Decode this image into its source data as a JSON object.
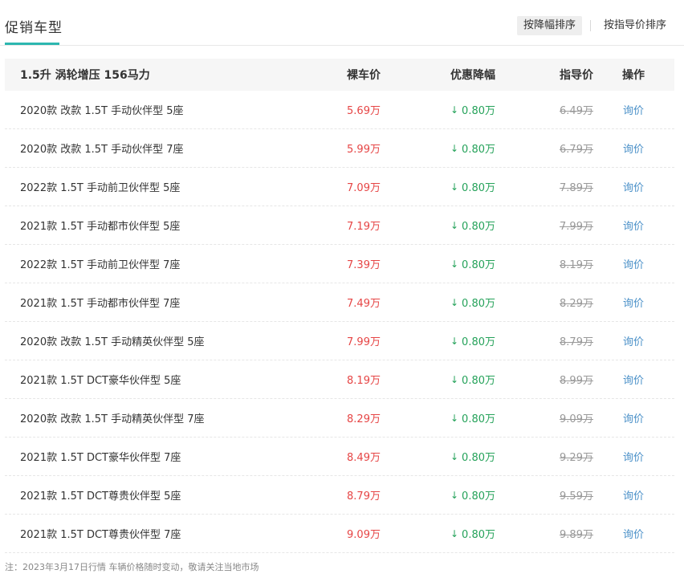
{
  "header": {
    "title": "促销车型",
    "sort_desc_label": "按降幅排序",
    "sort_guide_label": "按指导价排序"
  },
  "table": {
    "group_label": "1.5升 涡轮增压 156马力",
    "columns": [
      "裸车价",
      "优惠降幅",
      "指导价",
      "操作"
    ],
    "rows": [
      {
        "name": "2020款 改款 1.5T 手动伙伴型 5座",
        "price": "5.69万",
        "drop": "0.80万",
        "guide": "6.49万",
        "action": "询价"
      },
      {
        "name": "2020款 改款 1.5T 手动伙伴型 7座",
        "price": "5.99万",
        "drop": "0.80万",
        "guide": "6.79万",
        "action": "询价"
      },
      {
        "name": "2022款 1.5T 手动前卫伙伴型 5座",
        "price": "7.09万",
        "drop": "0.80万",
        "guide": "7.89万",
        "action": "询价"
      },
      {
        "name": "2021款 1.5T 手动都市伙伴型 5座",
        "price": "7.19万",
        "drop": "0.80万",
        "guide": "7.99万",
        "action": "询价"
      },
      {
        "name": "2022款 1.5T 手动前卫伙伴型 7座",
        "price": "7.39万",
        "drop": "0.80万",
        "guide": "8.19万",
        "action": "询价"
      },
      {
        "name": "2021款 1.5T 手动都市伙伴型 7座",
        "price": "7.49万",
        "drop": "0.80万",
        "guide": "8.29万",
        "action": "询价"
      },
      {
        "name": "2020款 改款 1.5T 手动精英伙伴型 5座",
        "price": "7.99万",
        "drop": "0.80万",
        "guide": "8.79万",
        "action": "询价"
      },
      {
        "name": "2021款 1.5T DCT豪华伙伴型 5座",
        "price": "8.19万",
        "drop": "0.80万",
        "guide": "8.99万",
        "action": "询价"
      },
      {
        "name": "2020款 改款 1.5T 手动精英伙伴型 7座",
        "price": "8.29万",
        "drop": "0.80万",
        "guide": "9.09万",
        "action": "询价"
      },
      {
        "name": "2021款 1.5T DCT豪华伙伴型 7座",
        "price": "8.49万",
        "drop": "0.80万",
        "guide": "9.29万",
        "action": "询价"
      },
      {
        "name": "2021款 1.5T DCT尊贵伙伴型 5座",
        "price": "8.79万",
        "drop": "0.80万",
        "guide": "9.59万",
        "action": "询价"
      },
      {
        "name": "2021款 1.5T DCT尊贵伙伴型 7座",
        "price": "9.09万",
        "drop": "0.80万",
        "guide": "9.89万",
        "action": "询价"
      }
    ]
  },
  "footer": {
    "note": "注：2023年3月17日行情 车辆价格随时变动，敬请关注当地市场"
  },
  "icons": {
    "drop_arrow": "arrow-down-icon"
  },
  "colors": {
    "accent": "#2db7b0",
    "price": "#e64545",
    "drop": "#25a25a",
    "link": "#4a90c8",
    "muted": "#999999"
  }
}
